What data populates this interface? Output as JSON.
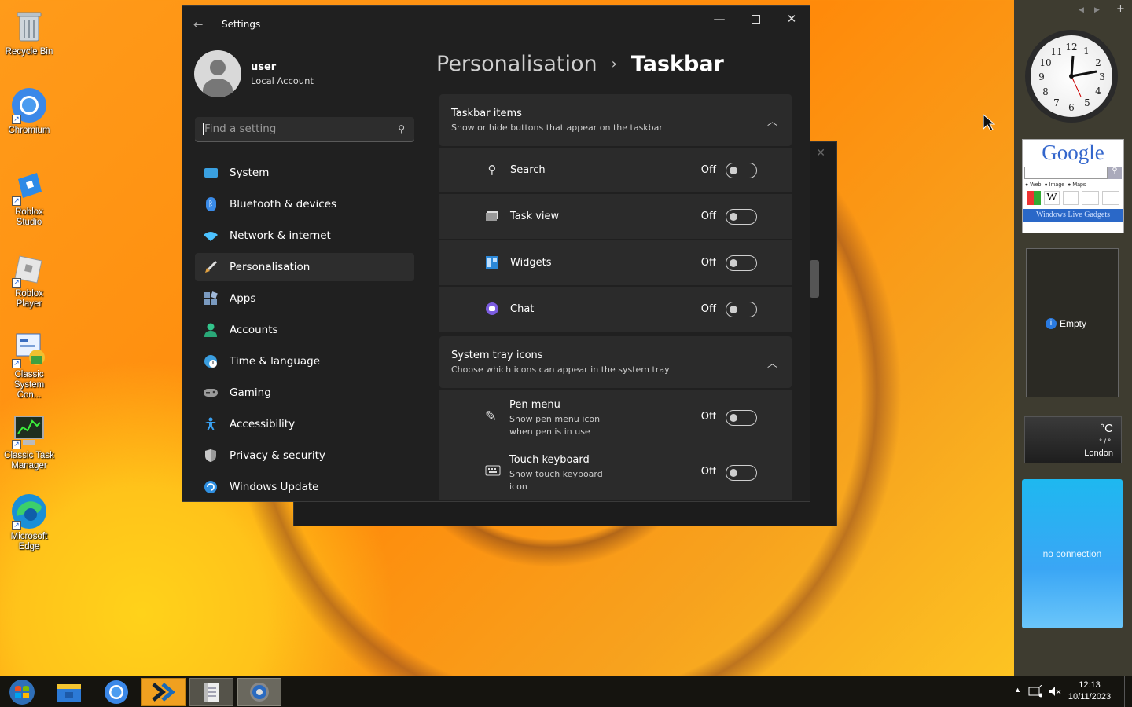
{
  "desktop": {
    "icons": [
      {
        "label": "Recycle Bin"
      },
      {
        "label": "Chromium"
      },
      {
        "label": "Roblox Studio"
      },
      {
        "label": "Roblox Player"
      },
      {
        "label": "Classic System Con..."
      },
      {
        "label": "Classic Task Manager"
      },
      {
        "label": "Microsoft Edge"
      }
    ]
  },
  "window": {
    "title": "Settings",
    "profile": {
      "name": "user",
      "type": "Local Account"
    },
    "search": {
      "placeholder": "Find a setting"
    },
    "nav": [
      {
        "label": "System",
        "icon": "system-icon",
        "color": "#3aa0e0"
      },
      {
        "label": "Bluetooth & devices",
        "icon": "bluetooth-icon",
        "color": "#3a8be8"
      },
      {
        "label": "Network & internet",
        "icon": "wifi-icon",
        "color": "#4cc2ff"
      },
      {
        "label": "Personalisation",
        "icon": "brush-icon",
        "color": "#e0a040"
      },
      {
        "label": "Apps",
        "icon": "apps-icon",
        "color": "#7a9ac0"
      },
      {
        "label": "Accounts",
        "icon": "person-icon",
        "color": "#33c48c"
      },
      {
        "label": "Time & language",
        "icon": "globe-clock-icon",
        "color": "#3a9ee0"
      },
      {
        "label": "Gaming",
        "icon": "gamepad-icon",
        "color": "#9a9a9a"
      },
      {
        "label": "Accessibility",
        "icon": "accessibility-icon",
        "color": "#3aa0f0"
      },
      {
        "label": "Privacy & security",
        "icon": "shield-icon",
        "color": "#9a9a9a"
      },
      {
        "label": "Windows Update",
        "icon": "update-icon",
        "color": "#2f8fe0"
      }
    ],
    "selected_nav": "Personalisation",
    "breadcrumb": {
      "parent": "Personalisation",
      "separator": "›",
      "current": "Taskbar"
    },
    "taskbar_items": {
      "heading": "Taskbar items",
      "desc": "Show or hide buttons that appear on the taskbar",
      "rows": [
        {
          "label": "Search",
          "state": "Off",
          "icon": "search-icon"
        },
        {
          "label": "Task view",
          "state": "Off",
          "icon": "task-view-icon"
        },
        {
          "label": "Widgets",
          "state": "Off",
          "icon": "widgets-icon"
        },
        {
          "label": "Chat",
          "state": "Off",
          "icon": "chat-icon"
        }
      ]
    },
    "tray_icons": {
      "heading": "System tray icons",
      "desc": "Choose which icons can appear in the system tray",
      "rows": [
        {
          "label": "Pen menu",
          "sub": "Show pen menu icon when pen is in use",
          "state": "Off",
          "icon": "pen-icon"
        },
        {
          "label": "Touch keyboard",
          "sub": "Show touch keyboard icon",
          "state": "Off",
          "icon": "keyboard-icon"
        }
      ]
    }
  },
  "sidebar": {
    "google_logo": "Google",
    "google_options": [
      "Web",
      "Image",
      "Maps"
    ],
    "google_footer": "Windows Live Gadgets",
    "empty_label": "Empty",
    "weather": {
      "unit": "°C",
      "range": "° / °",
      "city": "London"
    },
    "network": "no connection"
  },
  "taskbar": {
    "time": "12:13",
    "date": "10/11/2023"
  }
}
